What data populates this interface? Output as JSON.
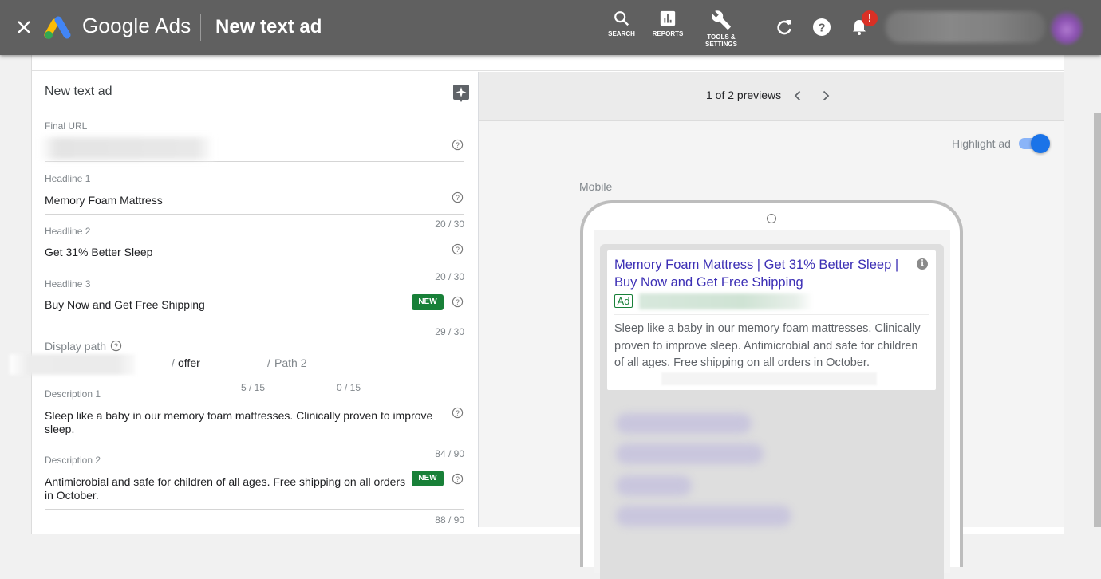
{
  "app": {
    "brand": "Google Ads",
    "page_title": "New text ad",
    "close_icon": "close-icon",
    "logo": "google-ads-logo"
  },
  "toolbar": {
    "items": [
      {
        "label": "SEARCH",
        "icon": "search-icon"
      },
      {
        "label": "REPORTS",
        "icon": "bar-chart-icon"
      },
      {
        "label_line1": "TOOLS &",
        "label_line2": "SETTINGS",
        "icon": "wrench-icon"
      }
    ],
    "refresh_icon": "refresh-icon",
    "help_icon": "help-icon",
    "notifications_icon": "bell-icon",
    "notification_badge": "!"
  },
  "form": {
    "title": "New text ad",
    "magic_icon": "sparkle-icon",
    "final_url": {
      "label": "Final URL"
    },
    "headline1": {
      "label": "Headline 1",
      "value": "Memory Foam Mattress",
      "counter": "20 / 30"
    },
    "headline2": {
      "label": "Headline 2",
      "value": "Get 31% Better Sleep",
      "counter": "20 / 30"
    },
    "headline3": {
      "label": "Headline 3",
      "value": "Buy Now and Get Free Shipping",
      "counter": "29 / 30",
      "badge": "NEW"
    },
    "display_path": {
      "label": "Display path",
      "separator": "/",
      "path1_value": "offer",
      "path1_counter": "5 / 15",
      "path2_placeholder": "Path 2",
      "path2_counter": "0 / 15"
    },
    "description1": {
      "label": "Description 1",
      "value": "Sleep like a baby in our memory foam mattresses. Clinically proven to improve sleep.",
      "counter": "84 / 90"
    },
    "description2": {
      "label": "Description 2",
      "value": "Antimicrobial and safe for children of all ages. Free shipping on all orders in October.",
      "counter": "88 / 90",
      "badge": "NEW"
    }
  },
  "preview": {
    "count_text": "1 of 2 previews",
    "highlight_label": "Highlight ad",
    "highlight_on": true,
    "device_label": "Mobile",
    "ad": {
      "headline": "Memory Foam Mattress | Get 31% Better Sleep | Buy Now and Get Free Shipping",
      "badge": "Ad",
      "description": "Sleep like a baby in our memory foam mattresses. Clinically proven to improve sleep. Antimicrobial and safe for children of all ages. Free shipping on all orders in October."
    }
  }
}
